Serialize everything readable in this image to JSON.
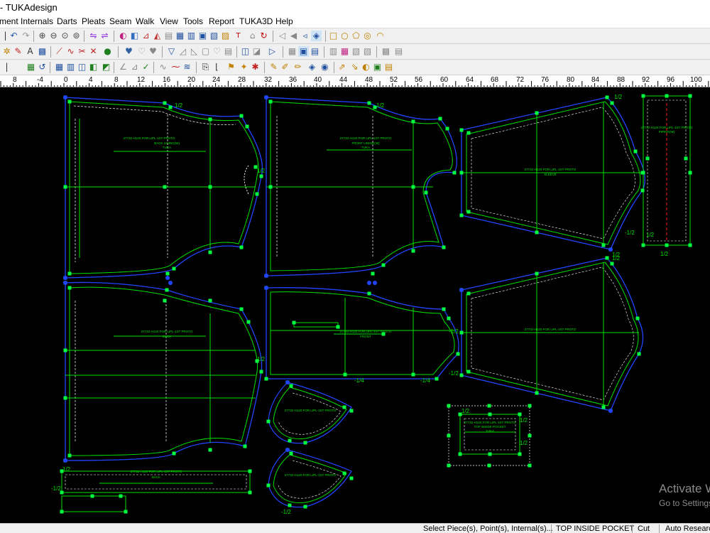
{
  "window": {
    "title": "- TUKAdesign"
  },
  "menu": [
    "ment",
    "Internals",
    "Darts",
    "Pleats",
    "Seam",
    "Walk",
    "View",
    "Tools",
    "Report",
    "TUKA3D",
    "Help"
  ],
  "ruler": {
    "labels": [
      "8",
      "-4",
      "0",
      "4",
      "8",
      "12",
      "16",
      "20",
      "24",
      "28",
      "32",
      "36",
      "40",
      "44",
      "48",
      "52",
      "56",
      "60",
      "64",
      "68",
      "72",
      "76",
      "80",
      "84",
      "88",
      "92",
      "96",
      "100"
    ]
  },
  "pieces": {
    "back": {
      "label1": "27732-H120 FOR LIPL-1ST PROTO",
      "label2": "BACK LINING(W)",
      "label3": "TUKA",
      "notch": "1/2"
    },
    "front": {
      "label1": "27732-H120 FOR LIPL-1ST PROTO",
      "label2": "FRONT LINING(W)",
      "label3": "TUKA",
      "notch": "1/2"
    },
    "sleeve": {
      "label1": "27732-H120 FOR LIPL-1ST PROTO",
      "label2": "SLEEVE",
      "notch": "1/2"
    },
    "strip": {
      "label1": "27732-H120 FOR LIPL-1ST PROTO",
      "label2": "PIPING(W)",
      "notch": "1/2"
    },
    "back2": {
      "label1": "27732-H120 FOR LIPL-1ST PROTO",
      "label2": "BACK"
    },
    "front2": {
      "label1": "27732-H120 FOR LIPL-1ST PROTO",
      "label2": "FRONT"
    },
    "sleeve2": {
      "label1": "27732-H120 FOR LIPL-1ST PROTO"
    },
    "pocket1": {
      "label1": "27732-H120 FOR LIPL-1ST PROTO"
    },
    "pocket2": {
      "label1": "27732-H120 FOR LIPL-1ST PROTO"
    },
    "waistband": {
      "label1": "27732-H120 FOR LIPL-1ST PROTO",
      "label2": "BACK"
    },
    "insidepocket": {
      "label1": "27732-H120 FOR LIPL-1ST PROTO",
      "label2": "TOP INSIDE POCKET",
      "label3": "TUKA",
      "notch": "1/2"
    },
    "minus_notch": "-1/2",
    "minus_quarter": "-1/4",
    "quarter": "1/4"
  },
  "watermark": {
    "line1": "Activate Windows",
    "line2": "Go to Settings to activate Windows."
  },
  "status": {
    "prompt": "Select Piece(s), Point(s), Internal(s)...",
    "piece": "TOP INSIDE POCKET",
    "mode": "Cut",
    "research": "Auto Research"
  },
  "colors": {
    "canvas": "#000000",
    "piece_outline": "#00e000",
    "seam_outline": "#2244ff",
    "point": "#00ff40",
    "grade": "#ffffff"
  }
}
